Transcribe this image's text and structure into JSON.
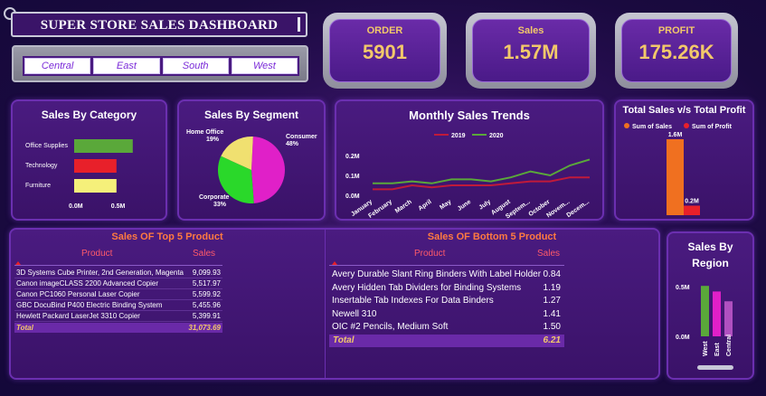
{
  "header": {
    "title": "SUPER STORE SALES DASHBOARD",
    "regions": [
      "Central",
      "East",
      "South",
      "West"
    ]
  },
  "kpis": [
    {
      "label": "ORDER",
      "value": "5901"
    },
    {
      "label": "Sales",
      "value": "1.57M"
    },
    {
      "label": "PROFIT",
      "value": "175.26K"
    }
  ],
  "colors": {
    "accent_gold": "#f2c86a",
    "panel": "#3a1268",
    "red": "#e8202a",
    "green": "#5aa83a"
  },
  "chart_data": [
    {
      "type": "bar",
      "title": "Sales By Category",
      "categories": [
        "Office Supplies",
        "Technology",
        "Furniture"
      ],
      "values": [
        0.72,
        0.52,
        0.52
      ],
      "colors": [
        "#5aa83a",
        "#e8202a",
        "#f5f07a"
      ],
      "xticks": [
        "0.0M",
        "0.5M"
      ],
      "xlim": [
        0,
        1.0
      ]
    },
    {
      "type": "pie",
      "title": "Sales By Segment",
      "categories": [
        "Consumer",
        "Corporate",
        "Home Office"
      ],
      "values": [
        48,
        33,
        19
      ],
      "labels": [
        "48%",
        "33%",
        "19%"
      ],
      "colors": [
        "#e020c8",
        "#2ad82a",
        "#f0e070"
      ]
    },
    {
      "type": "line",
      "title": "Monthly Sales Trends",
      "categories": [
        "January",
        "February",
        "March",
        "April",
        "May",
        "June",
        "July",
        "August",
        "Septem...",
        "October",
        "Novem...",
        "Decem..."
      ],
      "series": [
        {
          "name": "2019",
          "color": "#c01a3a",
          "values": [
            0.03,
            0.03,
            0.05,
            0.04,
            0.05,
            0.05,
            0.05,
            0.06,
            0.07,
            0.07,
            0.09,
            0.09
          ]
        },
        {
          "name": "2020",
          "color": "#5aa83a",
          "values": [
            0.06,
            0.06,
            0.07,
            0.06,
            0.08,
            0.08,
            0.07,
            0.09,
            0.12,
            0.1,
            0.15,
            0.18
          ]
        }
      ],
      "yticks": [
        "0.0M",
        "0.1M",
        "0.2M"
      ],
      "ylim": [
        0,
        0.2
      ]
    },
    {
      "type": "bar",
      "title": "Total Sales v/s Total Profit",
      "series": [
        {
          "name": "Sum of Sales",
          "value": 1.6,
          "label": "1.6M",
          "color": "#f07020"
        },
        {
          "name": "Sum of Profit",
          "value": 0.2,
          "label": "0.2M",
          "color": "#e8202a"
        }
      ]
    },
    {
      "type": "bar",
      "title": "Sales By Region",
      "categories": [
        "West",
        "East",
        "Central"
      ],
      "values": [
        0.72,
        0.64,
        0.5
      ],
      "colors": [
        "#5aa83a",
        "#e020c8",
        "#b050c0"
      ],
      "yticks": [
        "0.5M",
        "0.0M"
      ],
      "ylim": [
        0,
        0.8
      ]
    }
  ],
  "top5": {
    "title": "Sales OF Top 5 Product",
    "col_product": "Product",
    "col_sales": "Sales",
    "rows": [
      {
        "product": "3D Systems Cube Printer, 2nd Generation, Magenta",
        "sales": "9,099.93"
      },
      {
        "product": "Canon imageCLASS 2200 Advanced Copier",
        "sales": "5,517.97"
      },
      {
        "product": "Canon PC1060 Personal Laser Copier",
        "sales": "5,599.92"
      },
      {
        "product": "GBC DocuBind P400 Electric Binding System",
        "sales": "5,455.96"
      },
      {
        "product": "Hewlett Packard LaserJet 3310 Copier",
        "sales": "5,399.91"
      }
    ],
    "total_label": "Total",
    "total_value": "31,073.69"
  },
  "bottom5": {
    "title": "Sales OF Bottom 5 Product",
    "col_product": "Product",
    "col_sales": "Sales",
    "rows": [
      {
        "product": "Avery Durable Slant Ring Binders With Label Holder",
        "sales": "0.84"
      },
      {
        "product": "Avery Hidden Tab Dividers for Binding Systems",
        "sales": "1.19"
      },
      {
        "product": "Insertable Tab Indexes For Data Binders",
        "sales": "1.27"
      },
      {
        "product": "Newell 310",
        "sales": "1.41"
      },
      {
        "product": "OIC #2 Pencils, Medium Soft",
        "sales": "1.50"
      }
    ],
    "total_label": "Total",
    "total_value": "6.21"
  }
}
